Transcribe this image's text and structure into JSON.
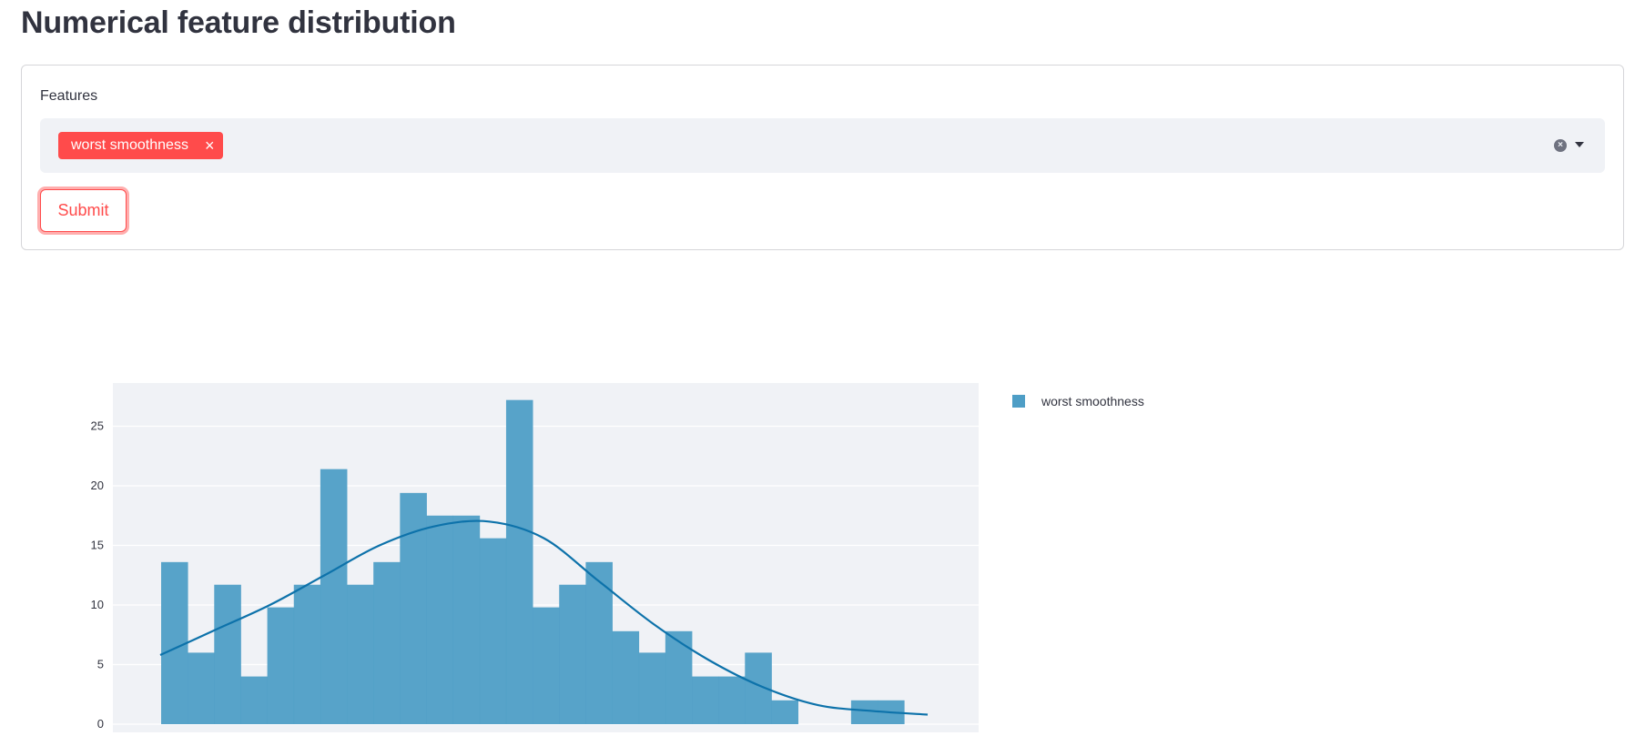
{
  "page": {
    "title": "Numerical feature distribution"
  },
  "form": {
    "label": "Features",
    "selected_tags": [
      "worst smoothness"
    ],
    "tag_close_symbol": "×",
    "clear_symbol": "×",
    "submit_label": "Submit"
  },
  "colors": {
    "accent": "#ff4b4b",
    "bar": "#4e9ec6",
    "curve": "#0d72aa",
    "plot_bg": "#f0f2f6"
  },
  "chart_data": {
    "type": "bar",
    "title": "",
    "xlabel": "",
    "ylabel": "",
    "ylim": [
      0,
      27
    ],
    "yticks": [
      0,
      5,
      10,
      15,
      20,
      25
    ],
    "grid": true,
    "legend_position": "right",
    "series": [
      {
        "name": "worst smoothness",
        "values": [
          13.6,
          6,
          11.7,
          4,
          9.8,
          11.7,
          21.4,
          11.7,
          13.6,
          19.4,
          17.5,
          17.5,
          15.6,
          27.2,
          9.8,
          11.7,
          13.6,
          7.8,
          6,
          7.8,
          4,
          4,
          6,
          2,
          0,
          0,
          2,
          2
        ]
      },
      {
        "type": "line",
        "values": [
          5.8,
          7.9,
          10.0,
          12.5,
          15.0,
          16.6,
          17.0,
          15.6,
          12.0,
          8.4,
          5.4,
          3.1,
          1.6,
          1.1,
          0.8
        ]
      }
    ]
  }
}
